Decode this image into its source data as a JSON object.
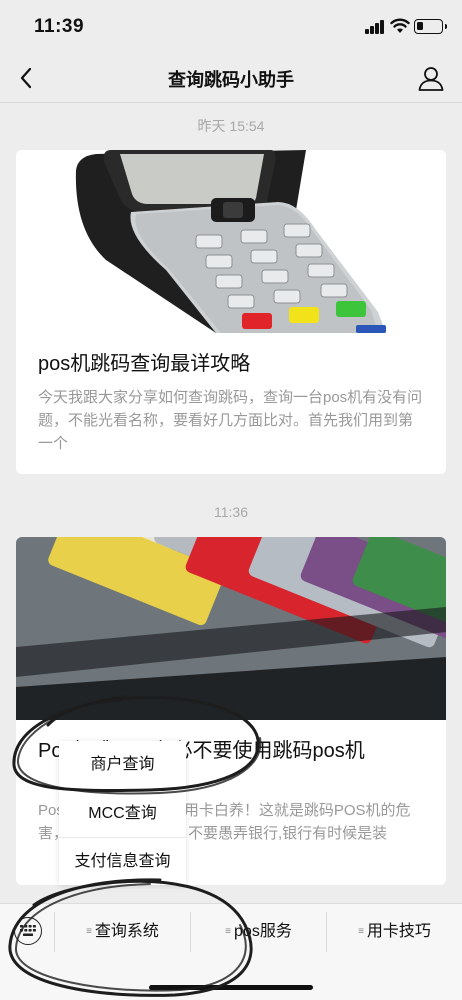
{
  "status_bar": {
    "time": "11:39",
    "battery_level": 0.25
  },
  "nav": {
    "title": "查询跳码小助手"
  },
  "messages": [
    {
      "timestamp": "昨天 15:54",
      "title": "pos机跳码查询最详攻略",
      "desc": "今天我跟大家分享如何查询跳码，查询一台pos机有没有问题，不能光看名称，要看好几方面比对。首先我们用到第一个"
    },
    {
      "timestamp": "11:36",
      "title": "Pos机跳码，务必不要使用跳码pos机",
      "desc": "Pos机跳码，会让您信用卡白养！这就是跳码POS机的危害，使用正规的方式，不要愚弄银行,银行有时候是装"
    }
  ],
  "popup_menu": {
    "items": [
      "商户查询",
      "MCC查询",
      "支付信息查询"
    ]
  },
  "bottom_menu": {
    "items": [
      "查询系统",
      "pos服务",
      "用卡技巧"
    ]
  }
}
